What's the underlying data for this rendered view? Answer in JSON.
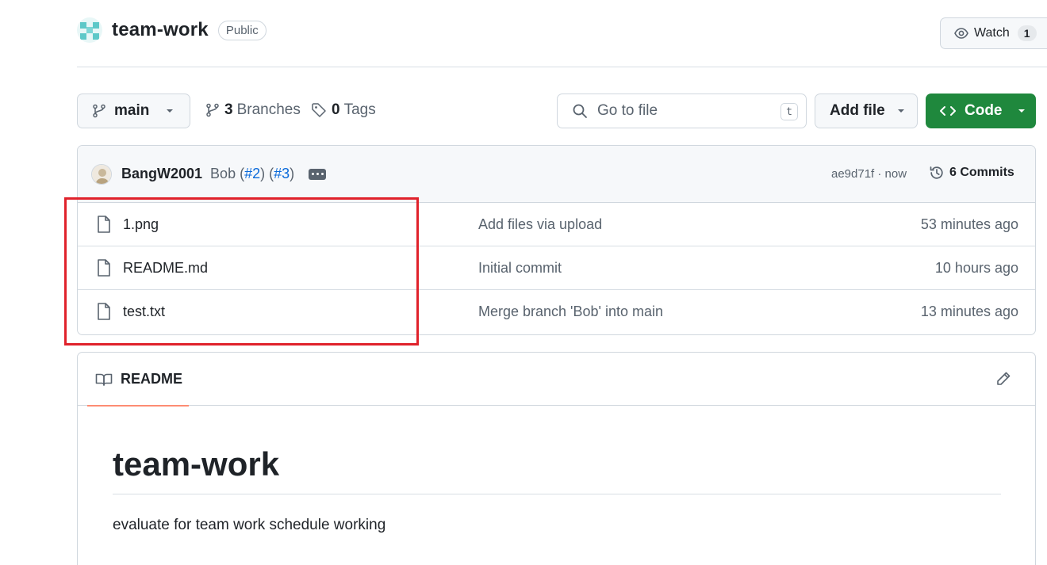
{
  "repo": {
    "name": "team-work",
    "visibility": "Public"
  },
  "watch": {
    "label": "Watch",
    "count": "1"
  },
  "toolbar": {
    "branch": "main",
    "branches_count": "3",
    "branches_label": "Branches",
    "tags_count": "0",
    "tags_label": "Tags",
    "goto_placeholder": "Go to file",
    "goto_shortcut": "t",
    "add_file_label": "Add file",
    "code_label": "Code"
  },
  "commit": {
    "author": "BangW2001",
    "message_prefix": "Bob (",
    "pr1": "#2",
    "message_mid": ") (",
    "pr2": "#3",
    "message_suffix": ")",
    "hash": "ae9d71f · now",
    "commits_label": "6 Commits"
  },
  "files": [
    {
      "name": "1.png",
      "message": "Add files via upload",
      "time": "53 minutes ago"
    },
    {
      "name": "README.md",
      "message": "Initial commit",
      "time": "10 hours ago"
    },
    {
      "name": "test.txt",
      "message": "Merge branch 'Bob' into main",
      "time": "13 minutes ago"
    }
  ],
  "readme": {
    "tab_label": "README",
    "title": "team-work",
    "description": "evaluate for team work schedule working"
  },
  "colors": {
    "accent_green": "#1f883d",
    "link_blue": "#0969da",
    "highlight_red": "#e0222b",
    "tab_underline": "#fd8c73"
  }
}
